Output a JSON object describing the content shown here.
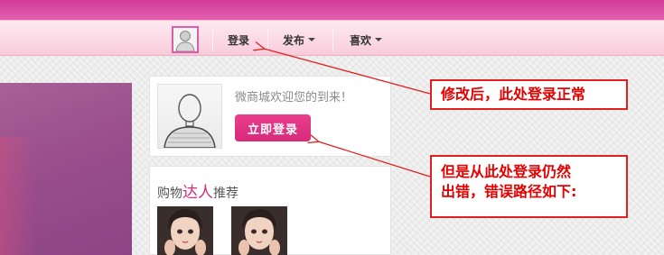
{
  "navbar": {
    "login": "登录",
    "publish": "发布",
    "favorites": "喜欢"
  },
  "welcome": {
    "message": "微商城欢迎您的到来！",
    "login_button": "立即登录"
  },
  "talent": {
    "title_prefix": "购物",
    "title_accent": "达人",
    "title_suffix": "推荐"
  },
  "annotations": {
    "note1": "修改后，此处登录正常",
    "note2_line1": "但是从此处登录仍然",
    "note2_line2": "出错，错误路径如下:"
  },
  "colors": {
    "brand_pink": "#d72a7a",
    "annotation_red": "#e60000"
  }
}
